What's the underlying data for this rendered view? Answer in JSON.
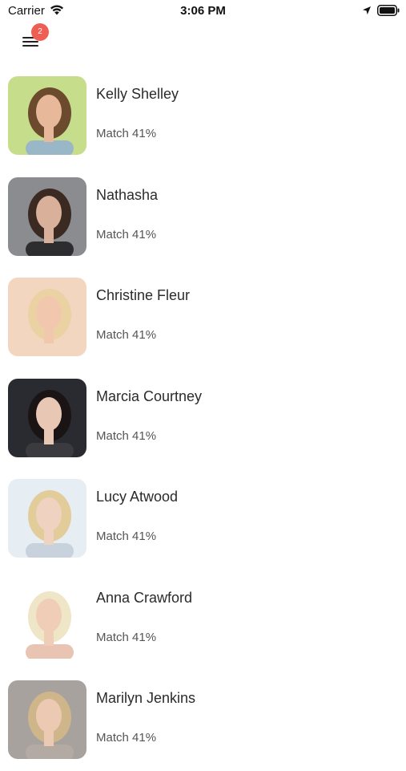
{
  "status_bar": {
    "carrier": "Carrier",
    "time": "3:06 PM"
  },
  "menu": {
    "badge_count": "2"
  },
  "matches": [
    {
      "name": "Kelly Shelley",
      "match_label": "Match 41%",
      "photo": {
        "bg": "#c6dd8c",
        "hair": "#6b4a2e",
        "skin": "#e7b99a",
        "top": "#9ab7c7"
      }
    },
    {
      "name": "Nathasha",
      "match_label": "Match 41%",
      "photo": {
        "bg": "#8a8c90",
        "hair": "#3a2a22",
        "skin": "#d9b09a",
        "top": "#2d2d2f"
      }
    },
    {
      "name": "Christine Fleur",
      "match_label": "Match 41%",
      "photo": {
        "bg": "#f2d6bf",
        "hair": "#ead2a3",
        "skin": "#f1c8ad",
        "top": "#f2d6bf"
      }
    },
    {
      "name": "Marcia Courtney",
      "match_label": "Match 41%",
      "photo": {
        "bg": "#2a2b30",
        "hair": "#1a1414",
        "skin": "#e8c8b5",
        "top": "#3a3a3f"
      }
    },
    {
      "name": "Lucy Atwood",
      "match_label": "Match 41%",
      "photo": {
        "bg": "#e6edf3",
        "hair": "#e2cc9a",
        "skin": "#efd3c0",
        "top": "#c8d2dc"
      }
    },
    {
      "name": "Anna Crawford",
      "match_label": "Match 41%",
      "photo": {
        "bg": "#ffffff",
        "hair": "#efe6c8",
        "skin": "#f0cdb6",
        "top": "#e9c4b3"
      }
    },
    {
      "name": "Marilyn Jenkins",
      "match_label": "Match 41%",
      "photo": {
        "bg": "#a8a29e",
        "hair": "#cfb58a",
        "skin": "#ecc9b2",
        "top": "#b4aaa4"
      }
    }
  ],
  "colors": {
    "badge": "#ef5e52",
    "text_primary": "#2b2b2b",
    "text_secondary": "#555555"
  }
}
